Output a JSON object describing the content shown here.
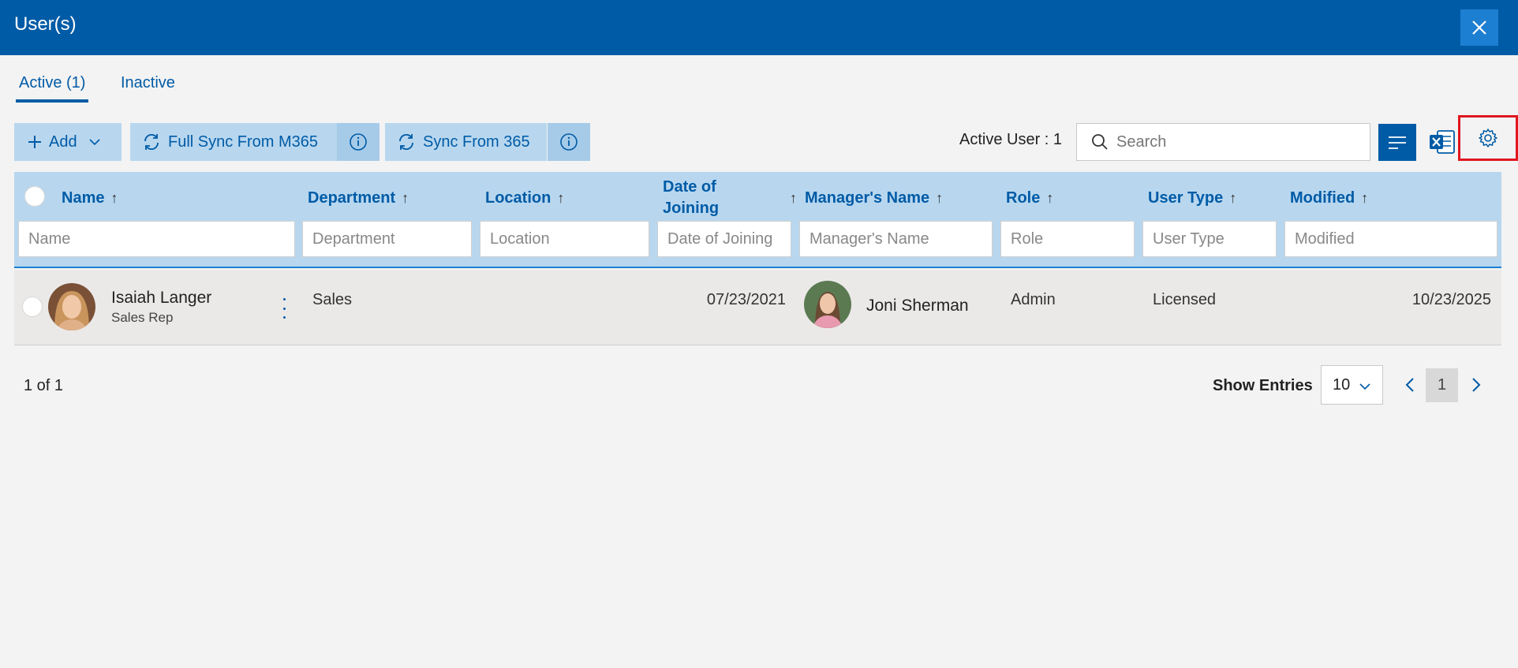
{
  "window": {
    "title": "User(s)"
  },
  "tabs": [
    {
      "label": "Active (1)",
      "active": true
    },
    {
      "label": "Inactive",
      "active": false
    }
  ],
  "toolbar": {
    "add_label": "Add",
    "full_sync_label": "Full Sync From M365",
    "sync_label": "Sync From 365",
    "active_user_label": "Active User : 1",
    "search_placeholder": "Search",
    "icons": [
      "plus-icon",
      "chevron-down-icon",
      "sync-icon",
      "info-icon",
      "search-icon",
      "list-icon",
      "excel-icon",
      "gear-icon",
      "close-icon"
    ]
  },
  "columns": [
    {
      "label": "Name",
      "filter_placeholder": "Name"
    },
    {
      "label": "Department",
      "filter_placeholder": "Department"
    },
    {
      "label": "Location",
      "filter_placeholder": "Location"
    },
    {
      "label": "Date of Joining",
      "filter_placeholder": "Date of Joining"
    },
    {
      "label": "Manager's Name",
      "filter_placeholder": "Manager's Name"
    },
    {
      "label": "Role",
      "filter_placeholder": "Role"
    },
    {
      "label": "User Type",
      "filter_placeholder": "User Type"
    },
    {
      "label": "Modified",
      "filter_placeholder": "Modified"
    }
  ],
  "sort_arrow": "↑",
  "rows": [
    {
      "name": "Isaiah Langer",
      "title": "Sales Rep",
      "department": "Sales",
      "location": "",
      "date_of_joining": "07/23/2021",
      "manager": "Joni Sherman",
      "role": "Admin",
      "user_type": "Licensed",
      "modified": "10/23/2025"
    }
  ],
  "footer": {
    "count": "1 of 1",
    "show_entries_label": "Show Entries",
    "entries_value": "10",
    "current_page": "1"
  },
  "colors": {
    "brand": "#005ba6",
    "header_bg": "#b8d7ef",
    "highlight_border": "#e0161e"
  }
}
